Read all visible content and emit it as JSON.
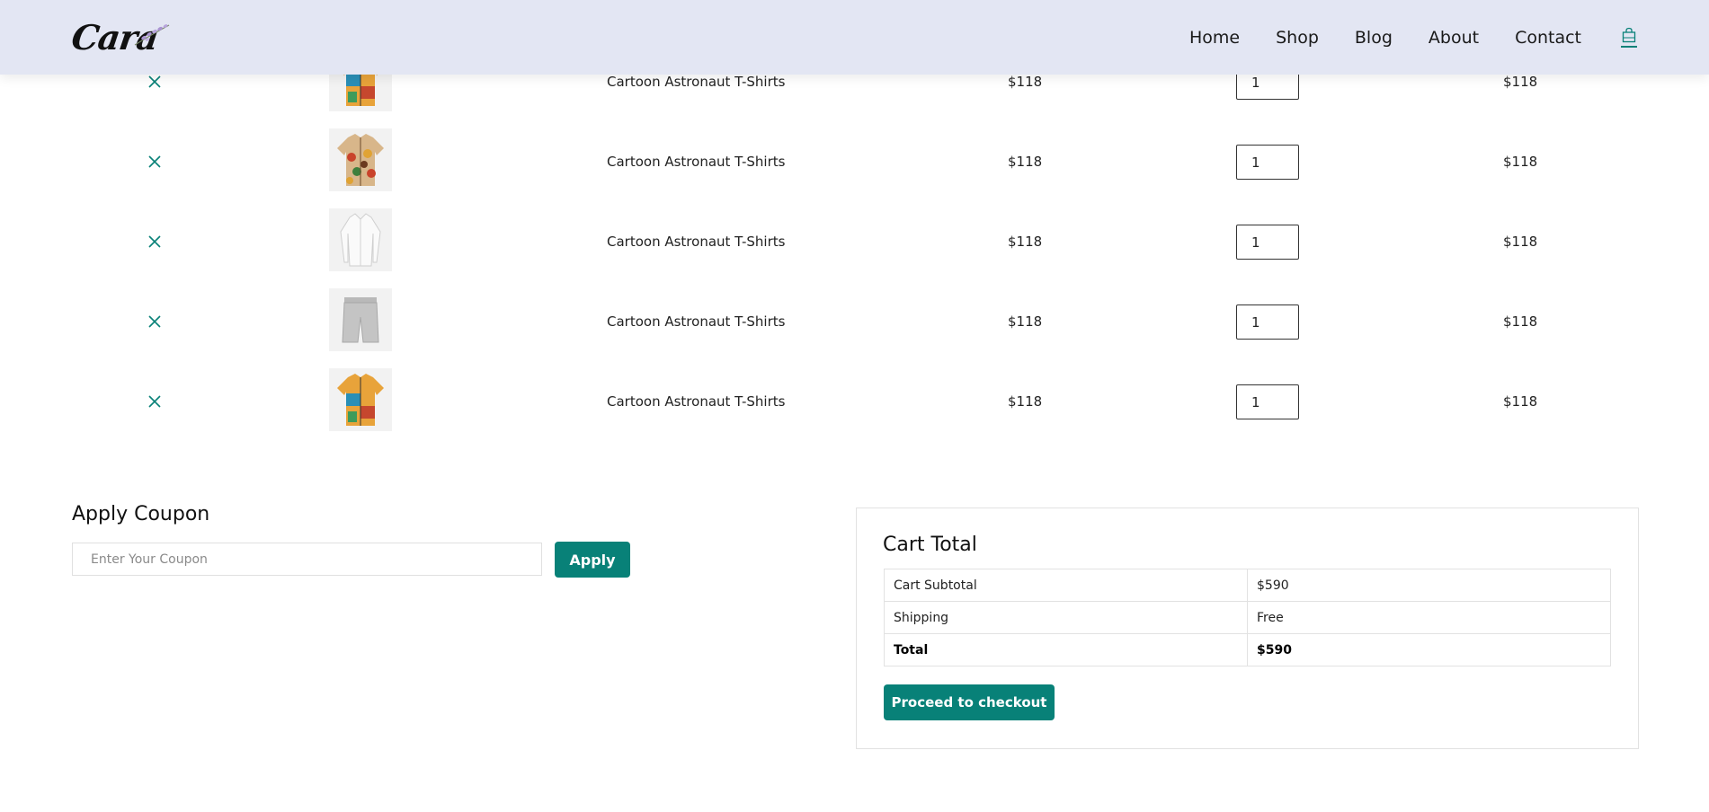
{
  "brand": {
    "logo_text": "Cara"
  },
  "nav": {
    "items": [
      "Home",
      "Shop",
      "Blog",
      "About",
      "Contact"
    ],
    "cart_icon": "shopping-bag-icon",
    "active_color": "#088178"
  },
  "cart": {
    "rows": [
      {
        "name": "Cartoon Astronaut T-Shirts",
        "price": "$118",
        "quantity": "1",
        "subtotal": "$118",
        "image": "colorful-shirt"
      },
      {
        "name": "Cartoon Astronaut T-Shirts",
        "price": "$118",
        "quantity": "1",
        "subtotal": "$118",
        "image": "floral-shirt"
      },
      {
        "name": "Cartoon Astronaut T-Shirts",
        "price": "$118",
        "quantity": "1",
        "subtotal": "$118",
        "image": "white-shirt"
      },
      {
        "name": "Cartoon Astronaut T-Shirts",
        "price": "$118",
        "quantity": "1",
        "subtotal": "$118",
        "image": "grey-shorts"
      },
      {
        "name": "Cartoon Astronaut T-Shirts",
        "price": "$118",
        "quantity": "1",
        "subtotal": "$118",
        "image": "colorful-shirt"
      }
    ],
    "remove_icon": "close-icon"
  },
  "coupon": {
    "title": "Apply Coupon",
    "placeholder": "Enter Your Coupon",
    "button_label": "Apply"
  },
  "totals": {
    "title": "Cart Total",
    "rows": [
      {
        "label": "Cart Subtotal",
        "value": "$590"
      },
      {
        "label": "Shipping",
        "value": "Free"
      },
      {
        "label": "Total",
        "value": "$590"
      }
    ],
    "checkout_label": "Proceed to checkout"
  },
  "colors": {
    "accent": "#088178",
    "header_bg": "#e3e6f3"
  }
}
